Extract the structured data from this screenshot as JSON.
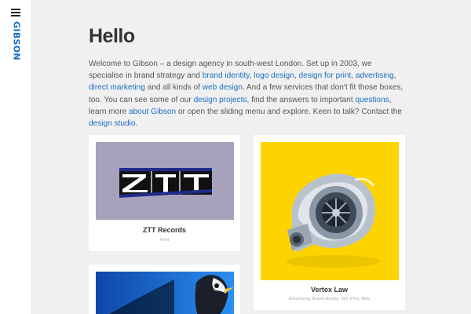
{
  "sidebar": {
    "menu_icon": "hamburger-icon",
    "logo_text": "GIBSON",
    "logo_color": "#1a6fc4"
  },
  "main": {
    "title": "Hello",
    "intro": {
      "t1": "Welcome to Gibson – a design agency in south-west London. Set up in 2003, we specialise in brand strategy and ",
      "l1": "brand identity",
      "t2": ", ",
      "l2": "logo design",
      "t3": ", ",
      "l3": "design for print",
      "t4": ", ",
      "l4": "advertising",
      "t5": ", ",
      "l5": "direct marketing",
      "t6": " and all kinds of ",
      "l6": "web design",
      "t7": ". And a few services that don't fit those boxes, too. You can see some of our ",
      "l7": "design projects",
      "t8": ", find the answers to important ",
      "l8": "questions",
      "t9": ", learn more ",
      "l9": "about Gibson",
      "t10": " or open the sliding menu and explore. Keen to talk? Contact the ",
      "l10": "design studio",
      "t11": "."
    },
    "link_color": "#1a6fc4"
  },
  "projects": [
    {
      "title": "ZTT Records",
      "tags": "Print",
      "logo_text": "ZTT",
      "thumb_color": "#a7a2bc"
    },
    {
      "title": "Vertex Law",
      "tags": "Advertising, Brand identity, DM, Print, Web",
      "thumb_color": "#fdd400"
    },
    {
      "title": "",
      "tags": "",
      "thumb_color": "#1565c8"
    }
  ]
}
